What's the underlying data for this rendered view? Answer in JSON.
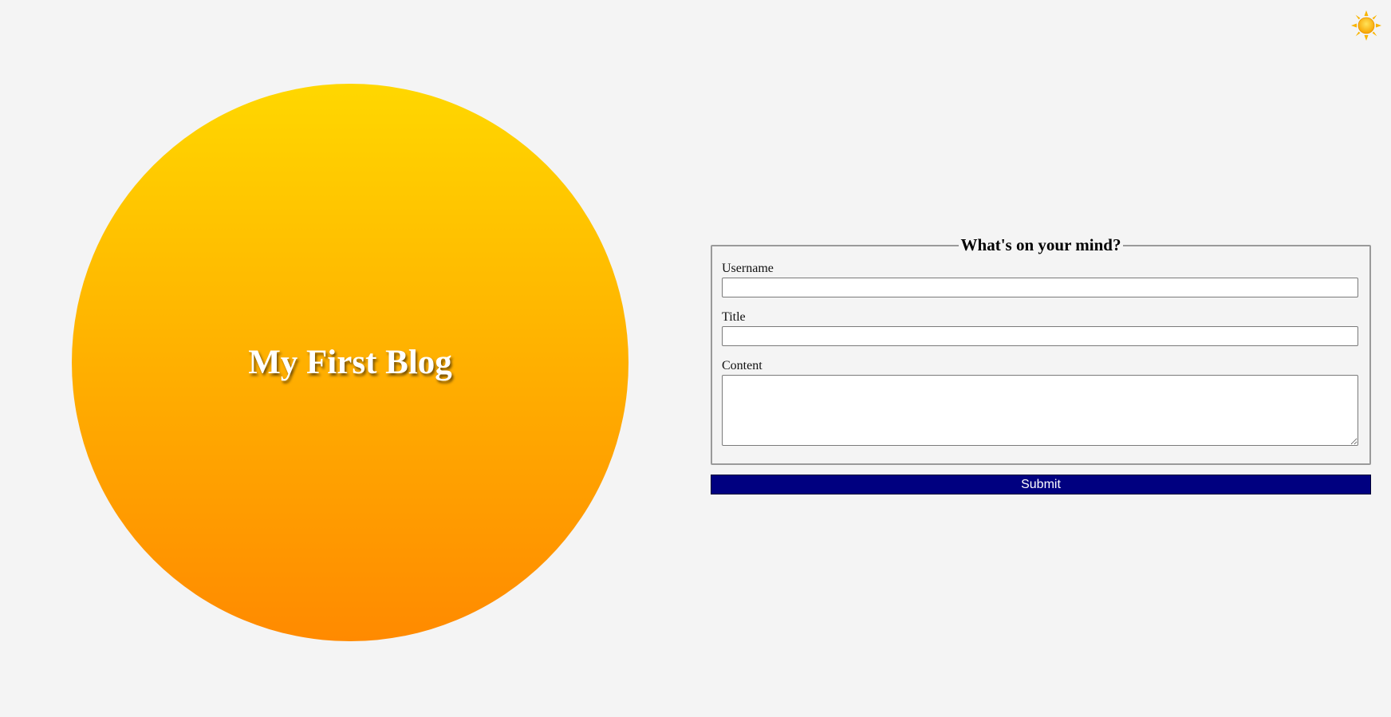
{
  "header": {
    "theme_toggle_icon": "sun-icon"
  },
  "hero": {
    "title": "My First Blog",
    "gradient_colors": [
      "#ffd700",
      "#ff8a00"
    ]
  },
  "form": {
    "legend": "What's on your mind?",
    "fields": {
      "username": {
        "label": "Username",
        "value": "",
        "placeholder": ""
      },
      "title": {
        "label": "Title",
        "value": "",
        "placeholder": ""
      },
      "content": {
        "label": "Content",
        "value": "",
        "placeholder": ""
      }
    },
    "submit_label": "Submit",
    "submit_color": "#000080"
  }
}
